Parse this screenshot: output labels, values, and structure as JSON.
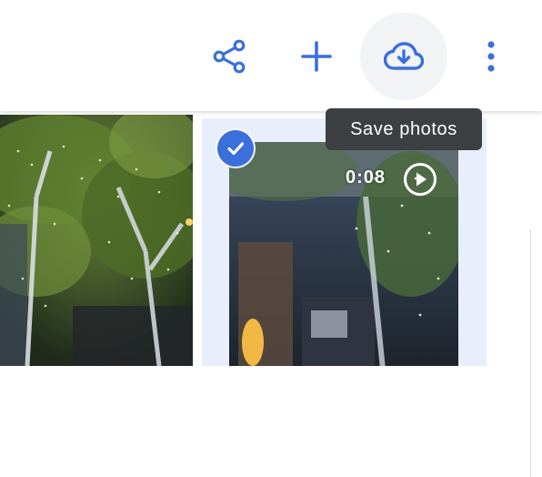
{
  "toolbar": {
    "buttons": [
      {
        "icon": "share-icon",
        "label": ""
      },
      {
        "icon": "add-icon",
        "label": ""
      },
      {
        "icon": "cloud-download-icon",
        "label": ""
      },
      {
        "icon": "more-vert-icon",
        "label": ""
      }
    ]
  },
  "tooltip": {
    "text": "Save photos"
  },
  "video": {
    "duration": "0:08"
  },
  "colors": {
    "accent": "#3a6fdc",
    "selected_tile_bg": "#e8eefc",
    "tooltip_bg": "#3c4043",
    "active_button_bg": "#f1f3f4"
  }
}
